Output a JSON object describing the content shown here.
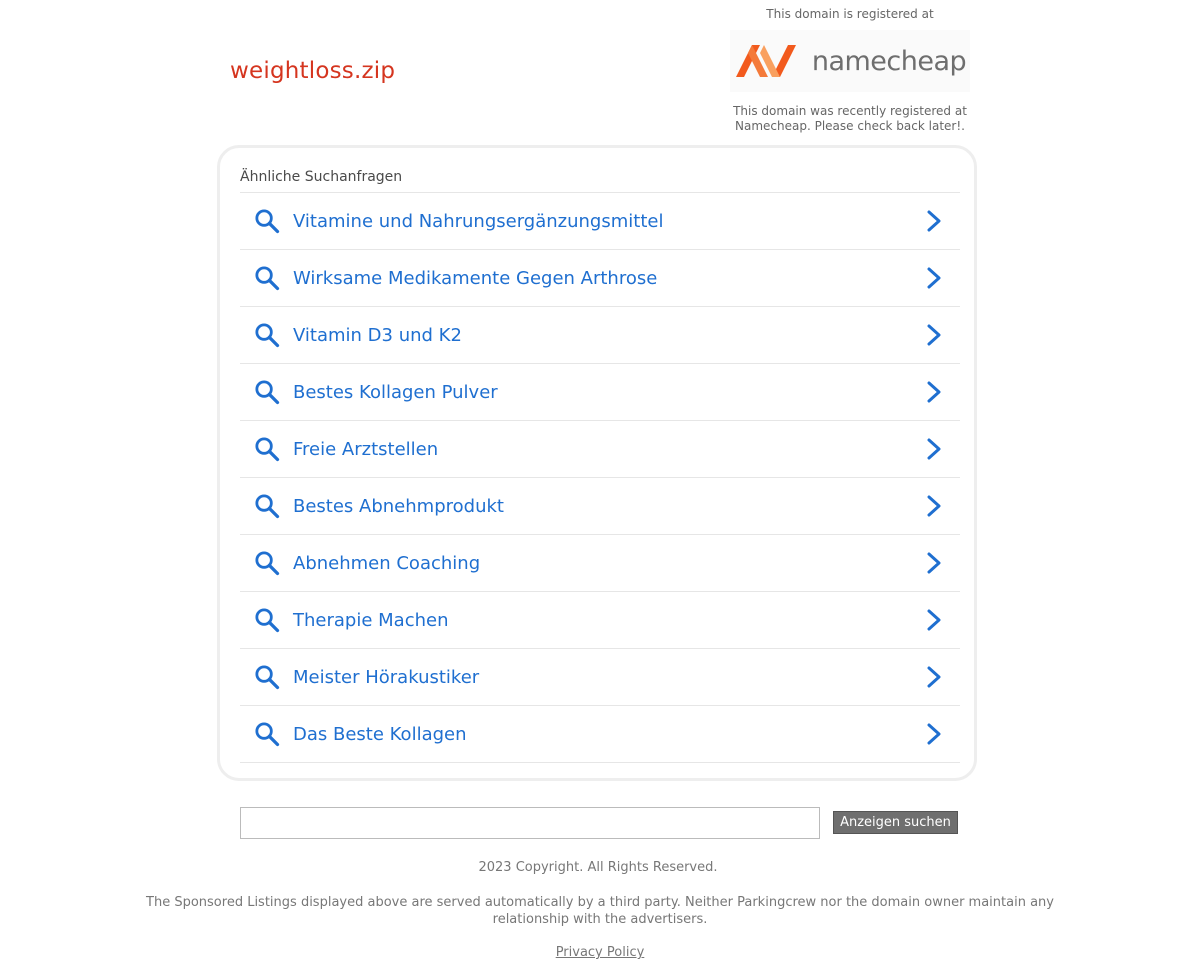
{
  "domain": "weightloss.zip",
  "registrar": {
    "top_text": "This domain is registered at",
    "logo_text": "namecheap",
    "bottom_text": "This domain was recently registered at Namecheap. Please check back later!."
  },
  "related": {
    "heading": "Ähnliche Suchanfragen",
    "items": [
      {
        "label": "Vitamine und Nahrungsergänzungsmittel"
      },
      {
        "label": "Wirksame Medikamente Gegen Arthrose"
      },
      {
        "label": "Vitamin D3 und K2"
      },
      {
        "label": "Bestes Kollagen Pulver"
      },
      {
        "label": "Freie Arztstellen"
      },
      {
        "label": "Bestes Abnehmprodukt"
      },
      {
        "label": "Abnehmen Coaching"
      },
      {
        "label": "Therapie Machen"
      },
      {
        "label": "Meister Hörakustiker"
      },
      {
        "label": "Das Beste Kollagen"
      }
    ]
  },
  "search": {
    "value": "",
    "placeholder": "",
    "button_label": "Anzeigen suchen"
  },
  "footer": {
    "copyright": "2023 Copyright. All Rights Reserved.",
    "disclaimer": "The Sponsored Listings displayed above are served automatically by a third party. Neither Parkingcrew nor the domain owner maintain any relationship with the advertisers.",
    "privacy_label": "Privacy Policy"
  },
  "colors": {
    "domain_title": "#d5351f",
    "link_blue": "#1f6fd0",
    "logo_orange": "#f25a1d",
    "button_gray": "#6f6f6f"
  },
  "icons": {
    "item_left": "search-icon",
    "item_right": "chevron-right-icon"
  }
}
